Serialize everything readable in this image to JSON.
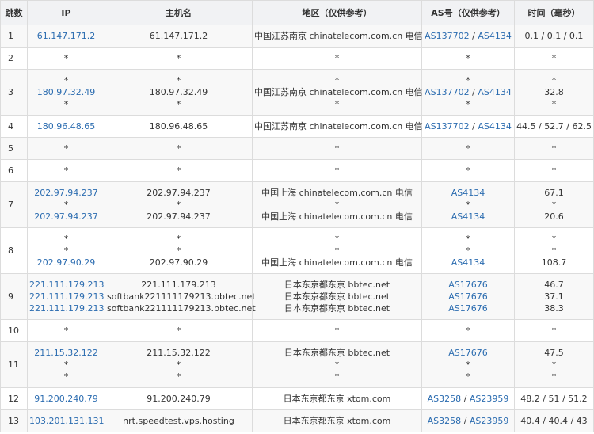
{
  "columns": [
    "跳数",
    "IP",
    "主机名",
    "地区（仅供参考）",
    "AS号（仅供参考）",
    "时间（毫秒）"
  ],
  "rows": [
    {
      "hop": "1",
      "lines": [
        {
          "ip": "61.147.171.2",
          "host": "61.147.171.2",
          "region": "中国江苏南京 chinatelecom.com.cn 电信",
          "as": [
            "AS137702",
            "AS4134"
          ],
          "time": "0.1 / 0.1 / 0.1"
        }
      ]
    },
    {
      "hop": "2",
      "lines": [
        {
          "ip": "*",
          "host": "*",
          "region": "*",
          "as": [
            "*"
          ],
          "time": "*"
        }
      ]
    },
    {
      "hop": "3",
      "lines": [
        {
          "ip": "*",
          "host": "*",
          "region": "*",
          "as": [
            "*"
          ],
          "time": "*"
        },
        {
          "ip": "180.97.32.49",
          "host": "180.97.32.49",
          "region": "中国江苏南京 chinatelecom.com.cn 电信",
          "as": [
            "AS137702",
            "AS4134"
          ],
          "time": "32.8"
        },
        {
          "ip": "*",
          "host": "*",
          "region": "*",
          "as": [
            "*"
          ],
          "time": "*"
        }
      ]
    },
    {
      "hop": "4",
      "lines": [
        {
          "ip": "180.96.48.65",
          "host": "180.96.48.65",
          "region": "中国江苏南京 chinatelecom.com.cn 电信",
          "as": [
            "AS137702",
            "AS4134"
          ],
          "time": "44.5 / 52.7 / 62.5"
        }
      ]
    },
    {
      "hop": "5",
      "lines": [
        {
          "ip": "*",
          "host": "*",
          "region": "*",
          "as": [
            "*"
          ],
          "time": "*"
        }
      ]
    },
    {
      "hop": "6",
      "lines": [
        {
          "ip": "*",
          "host": "*",
          "region": "*",
          "as": [
            "*"
          ],
          "time": "*"
        }
      ]
    },
    {
      "hop": "7",
      "lines": [
        {
          "ip": "202.97.94.237",
          "host": "202.97.94.237",
          "region": "中国上海 chinatelecom.com.cn 电信",
          "as": [
            "AS4134"
          ],
          "time": "67.1"
        },
        {
          "ip": "*",
          "host": "*",
          "region": "*",
          "as": [
            "*"
          ],
          "time": "*"
        },
        {
          "ip": "202.97.94.237",
          "host": "202.97.94.237",
          "region": "中国上海 chinatelecom.com.cn 电信",
          "as": [
            "AS4134"
          ],
          "time": "20.6"
        }
      ]
    },
    {
      "hop": "8",
      "lines": [
        {
          "ip": "*",
          "host": "*",
          "region": "*",
          "as": [
            "*"
          ],
          "time": "*"
        },
        {
          "ip": "*",
          "host": "*",
          "region": "*",
          "as": [
            "*"
          ],
          "time": "*"
        },
        {
          "ip": "202.97.90.29",
          "host": "202.97.90.29",
          "region": "中国上海 chinatelecom.com.cn 电信",
          "as": [
            "AS4134"
          ],
          "time": "108.7"
        }
      ]
    },
    {
      "hop": "9",
      "lines": [
        {
          "ip": "221.111.179.213",
          "host": "221.111.179.213",
          "region": "日本东京都东京 bbtec.net",
          "as": [
            "AS17676"
          ],
          "time": "46.7"
        },
        {
          "ip": "221.111.179.213",
          "host": "softbank221111179213.bbtec.net",
          "region": "日本东京都东京 bbtec.net",
          "as": [
            "AS17676"
          ],
          "time": "37.1"
        },
        {
          "ip": "221.111.179.213",
          "host": "softbank221111179213.bbtec.net",
          "region": "日本东京都东京 bbtec.net",
          "as": [
            "AS17676"
          ],
          "time": "38.3"
        }
      ]
    },
    {
      "hop": "10",
      "lines": [
        {
          "ip": "*",
          "host": "*",
          "region": "*",
          "as": [
            "*"
          ],
          "time": "*"
        }
      ]
    },
    {
      "hop": "11",
      "lines": [
        {
          "ip": "211.15.32.122",
          "host": "211.15.32.122",
          "region": "日本东京都东京 bbtec.net",
          "as": [
            "AS17676"
          ],
          "time": "47.5"
        },
        {
          "ip": "*",
          "host": "*",
          "region": "*",
          "as": [
            "*"
          ],
          "time": "*"
        },
        {
          "ip": "*",
          "host": "*",
          "region": "*",
          "as": [
            "*"
          ],
          "time": "*"
        }
      ]
    },
    {
      "hop": "12",
      "lines": [
        {
          "ip": "91.200.240.79",
          "host": "91.200.240.79",
          "region": "日本东京都东京 xtom.com",
          "as": [
            "AS3258",
            "AS23959"
          ],
          "time": "48.2 / 51 / 51.2"
        }
      ]
    },
    {
      "hop": "13",
      "lines": [
        {
          "ip": "103.201.131.131",
          "host": "nrt.speedtest.vps.hosting",
          "region": "日本东京都东京 xtom.com",
          "as": [
            "AS3258",
            "AS23959"
          ],
          "time": "40.4 / 40.4 / 43"
        }
      ]
    }
  ],
  "colors": {
    "link": "#2b6cb0",
    "header_bg": "#f1f2f4",
    "alt_row_bg": "#f8f8f8",
    "border": "#dcdcdc"
  }
}
